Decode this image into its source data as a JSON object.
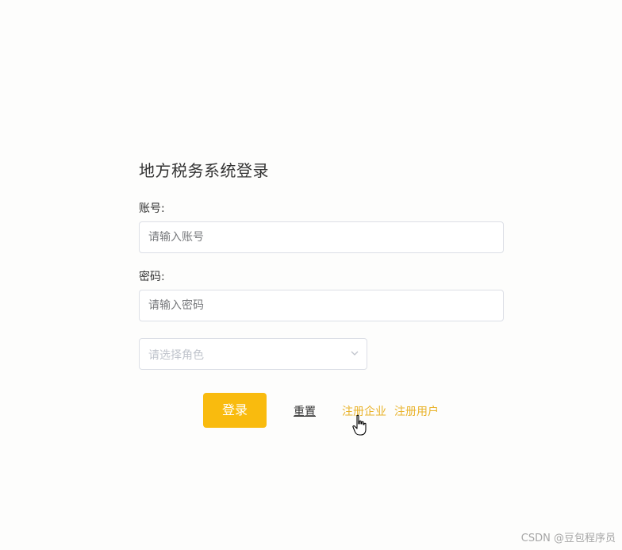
{
  "form": {
    "title": "地方税务系统登录",
    "account_label": "账号:",
    "account_placeholder": "请输入账号",
    "account_value": "",
    "password_label": "密码:",
    "password_placeholder": "请输入密码",
    "password_value": "",
    "role_placeholder": "请选择角色"
  },
  "actions": {
    "login_label": "登录",
    "reset_label": "重置",
    "register_company_label": "注册企业",
    "register_user_label": "注册用户"
  },
  "watermark": "CSDN @豆包程序员",
  "colors": {
    "accent": "#f9bb0e",
    "link": "#e9b32b",
    "border": "#dcdfe6",
    "placeholder": "#c0c4cc"
  },
  "icons": {
    "select_arrow": "chevron-down-icon",
    "cursor": "hand-pointer-icon"
  }
}
